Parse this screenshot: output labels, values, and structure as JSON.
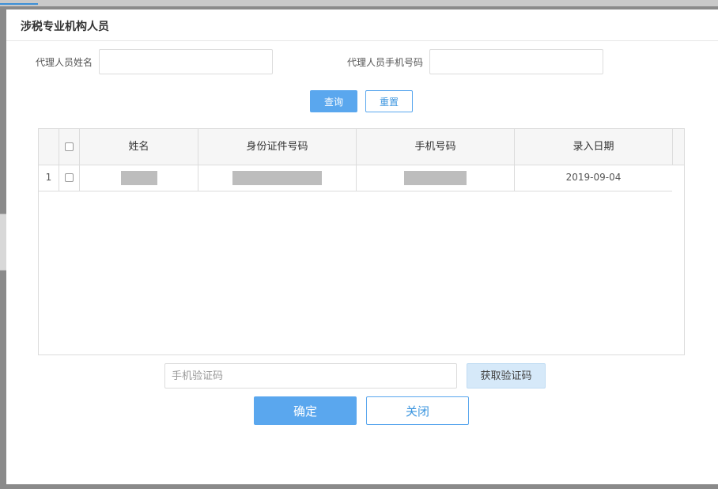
{
  "dialog": {
    "title": "涉税专业机构人员"
  },
  "filters": {
    "name_label": "代理人员姓名",
    "name_value": "",
    "phone_label": "代理人员手机号码",
    "phone_value": ""
  },
  "actions": {
    "query_label": "查询",
    "reset_label": "重置"
  },
  "table": {
    "columns": [
      "姓名",
      "身份证件号码",
      "手机号码",
      "录入日期"
    ],
    "rows": [
      {
        "index": "1",
        "name": "",
        "id_number": "",
        "phone": "",
        "date": "2019-09-04"
      }
    ]
  },
  "verification": {
    "placeholder": "手机验证码",
    "get_code_label": "获取验证码"
  },
  "footer": {
    "confirm_label": "确定",
    "close_label": "关闭"
  },
  "colors": {
    "primary": "#5aa7ee",
    "primary_light": "#d6e9f9",
    "border": "#dcdcdc",
    "header_bg": "#f6f6f6"
  }
}
